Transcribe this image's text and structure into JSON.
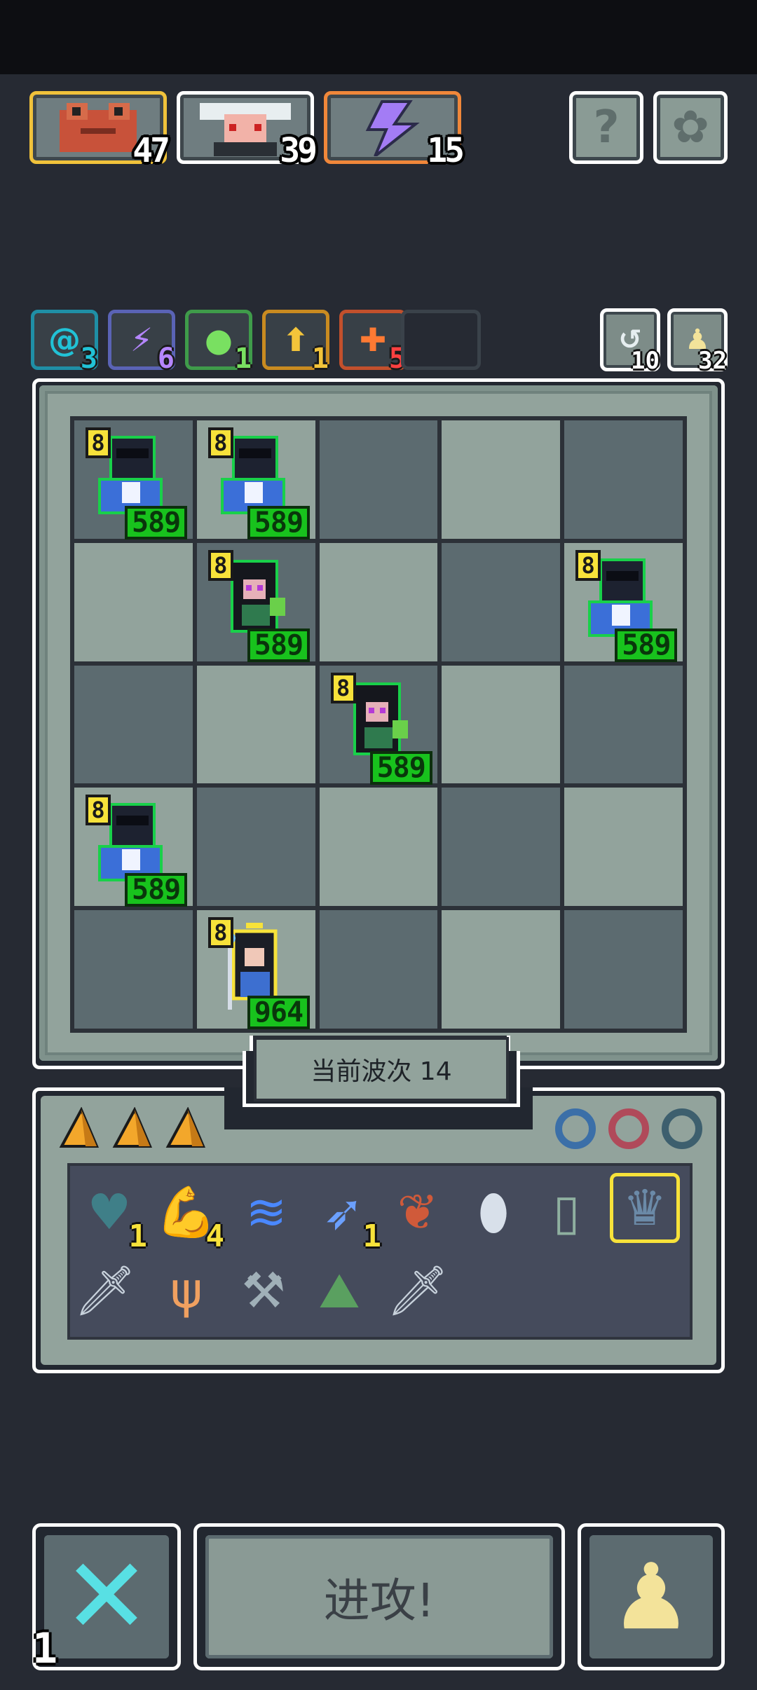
{
  "portraits": [
    {
      "name": "frog-portrait",
      "value": "47",
      "border": "#f0c23b"
    },
    {
      "name": "doctor-portrait",
      "value": "39",
      "border": "#ffffff"
    },
    {
      "name": "energy-portrait",
      "value": "15",
      "border": "#f0873a"
    }
  ],
  "system_buttons": {
    "help": {
      "icon": "question-icon",
      "glyph": "?"
    },
    "settings": {
      "icon": "gear-icon",
      "glyph": "✿"
    }
  },
  "synergies": [
    {
      "icon": "at-icon",
      "glyph": "@",
      "count": "3",
      "color": "#1f8fa6",
      "textcolor": "#21c2d6"
    },
    {
      "icon": "lightning-icon",
      "glyph": "⚡",
      "count": "6",
      "color": "#5a63b5",
      "textcolor": "#b586ff"
    },
    {
      "icon": "blob-icon",
      "glyph": "●",
      "count": "1",
      "color": "#3f9b4a",
      "textcolor": "#79e061"
    },
    {
      "icon": "arrow-up-icon",
      "glyph": "⬆",
      "count": "1",
      "color": "#c98b20",
      "textcolor": "#f3c43a"
    },
    {
      "icon": "cross-icon",
      "glyph": "✚",
      "count": "5",
      "color": "#c2502c",
      "textcolor": "#ff4040"
    }
  ],
  "resources": [
    {
      "icon": "refresh-icon",
      "glyph": "↺",
      "count": "10"
    },
    {
      "icon": "pawn-icon",
      "glyph": "♟",
      "count": "32"
    }
  ],
  "board": {
    "units": [
      {
        "row": 0,
        "col": 0,
        "type": "blue-knight",
        "level": "8",
        "hp": "589"
      },
      {
        "row": 0,
        "col": 1,
        "type": "blue-knight",
        "level": "8",
        "hp": "589"
      },
      {
        "row": 1,
        "col": 1,
        "type": "witch",
        "level": "8",
        "hp": "589"
      },
      {
        "row": 1,
        "col": 4,
        "type": "blue-knight",
        "level": "8",
        "hp": "589"
      },
      {
        "row": 2,
        "col": 2,
        "type": "witch",
        "level": "8",
        "hp": "589"
      },
      {
        "row": 3,
        "col": 0,
        "type": "blue-knight",
        "level": "8",
        "hp": "589"
      },
      {
        "row": 4,
        "col": 1,
        "type": "mage",
        "level": "8",
        "hp": "964",
        "selected": true
      }
    ]
  },
  "wave_label": "当前波次 14",
  "bench": {
    "materials": [
      "wedge-icon",
      "wedge-icon",
      "wedge-icon"
    ],
    "rings": [
      {
        "icon": "blue-ring-icon",
        "color": "#3b6fa8"
      },
      {
        "icon": "red-ring-icon",
        "color": "#b04a5a"
      },
      {
        "icon": "teal-ring-icon",
        "color": "#3d5f6e"
      }
    ],
    "items_row1": [
      {
        "icon": "heart-gem-icon",
        "glyph": "♥",
        "color": "#3f7f88",
        "count": "1"
      },
      {
        "icon": "arm-icon",
        "glyph": "💪",
        "color": "#e6895a",
        "count": "4"
      },
      {
        "icon": "water-spirit-icon",
        "glyph": "≋",
        "color": "#4a88ff",
        "count": ""
      },
      {
        "icon": "crossbow-icon",
        "glyph": "➶",
        "color": "#6ba0ff",
        "count": "1"
      },
      {
        "icon": "leaf-claw-icon",
        "glyph": "❦",
        "color": "#d05a3a",
        "count": ""
      },
      {
        "icon": "mirror-icon",
        "glyph": "⬮",
        "color": "#d8e0ea",
        "count": ""
      },
      {
        "icon": "phone-icon",
        "glyph": "▯",
        "color": "#8fb0a0",
        "count": ""
      },
      {
        "icon": "crown-claws-icon",
        "glyph": "♛",
        "color": "#6b8aa8",
        "count": "",
        "selected": true
      }
    ],
    "items_row2": [
      {
        "icon": "dagger-icon",
        "glyph": "🗡",
        "color": "#c8d2dc"
      },
      {
        "icon": "claw-icon",
        "glyph": "ψ",
        "color": "#f0a060"
      },
      {
        "icon": "axe-icon",
        "glyph": "⚒",
        "color": "#a0b0b8"
      },
      {
        "icon": "grass-rock-icon",
        "glyph": "⛰",
        "color": "#5aa060"
      },
      {
        "icon": "sword-icon",
        "glyph": "🗡",
        "color": "#c8d2dc"
      }
    ]
  },
  "buttons": {
    "cancel": {
      "icon": "x-icon",
      "glyph": "✕",
      "moves_left": "1"
    },
    "attack": {
      "label": "进攻!"
    },
    "pawn": {
      "icon": "pawn-icon",
      "glyph": "♟"
    }
  }
}
